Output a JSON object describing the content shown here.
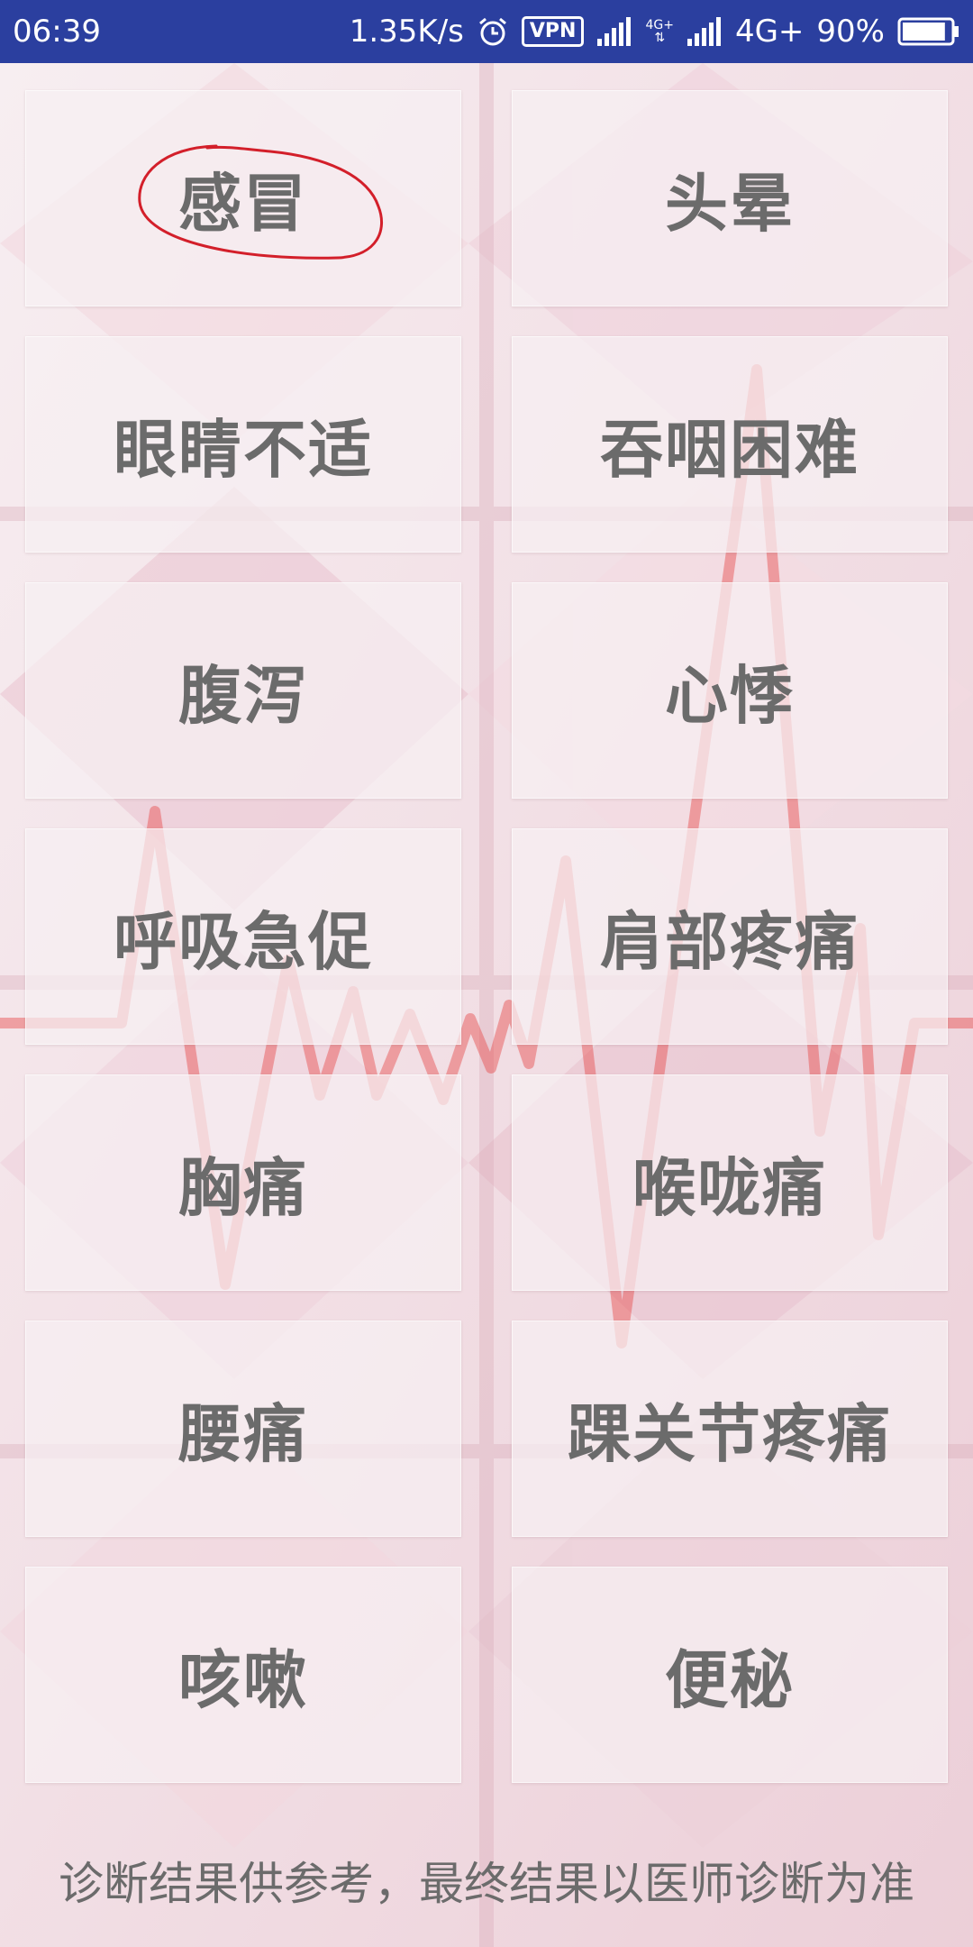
{
  "status_bar": {
    "time": "06:39",
    "speed": "1.35K/s",
    "vpn": "VPN",
    "net_top": "4G+",
    "net_type": "4G+",
    "battery": "90%",
    "battery_level": 0.9
  },
  "symptoms": [
    {
      "label": "感冒"
    },
    {
      "label": "头晕"
    },
    {
      "label": "眼睛不适"
    },
    {
      "label": "吞咽困难"
    },
    {
      "label": "腹泻"
    },
    {
      "label": "心悸"
    },
    {
      "label": "呼吸急促"
    },
    {
      "label": "肩部疼痛"
    },
    {
      "label": "胸痛"
    },
    {
      "label": "喉咙痛"
    },
    {
      "label": "腰痛"
    },
    {
      "label": "踝关节疼痛"
    },
    {
      "label": "咳嗽"
    },
    {
      "label": "便秘"
    }
  ],
  "disclaimer": "诊断结果供参考，最终结果以医师诊断为准",
  "colors": {
    "status_bar": "#2b3f9f",
    "ecg_line": "#e64a4a",
    "annotation": "#d31f2a",
    "text": "#6b6b6b"
  }
}
